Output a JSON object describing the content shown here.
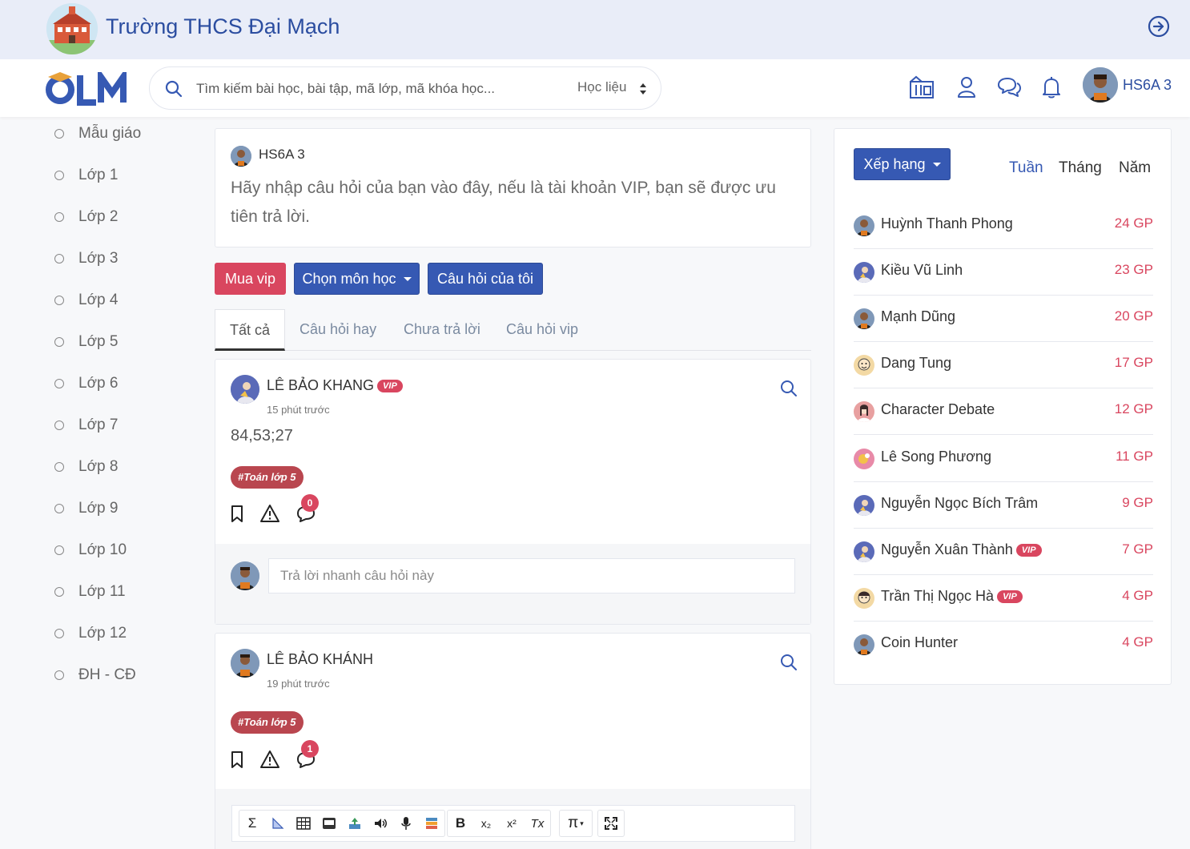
{
  "school": {
    "name": "Trường THCS Đại Mạch"
  },
  "navbar": {
    "logo_text": "OLM",
    "search_placeholder": "Tìm kiếm bài học, bài tập, mã lớp, mã khóa học...",
    "search_scope": "Học liệu",
    "user_name": "HS6A 3"
  },
  "sidebar": {
    "items": [
      "Mẫu giáo",
      "Lớp 1",
      "Lớp 2",
      "Lớp 3",
      "Lớp 4",
      "Lớp 5",
      "Lớp 6",
      "Lớp 7",
      "Lớp 8",
      "Lớp 9",
      "Lớp 10",
      "Lớp 11",
      "Lớp 12",
      "ĐH - CĐ"
    ]
  },
  "ask": {
    "user": "HS6A 3",
    "prompt": "Hãy nhập câu hỏi của bạn vào đây, nếu là tài khoản VIP, bạn sẽ được ưu tiên trả lời."
  },
  "actions": {
    "buy_vip": "Mua vip",
    "choose_subject": "Chọn môn học",
    "my_questions": "Câu hỏi của tôi"
  },
  "tabs": [
    "Tất cả",
    "Câu hỏi hay",
    "Chưa trả lời",
    "Câu hỏi vip"
  ],
  "questions": [
    {
      "author": "LÊ BẢO KHANG",
      "vip": "VIP",
      "time": "15 phút trước",
      "body": "84,53;27",
      "tag": "#Toán lớp 5",
      "comments": "0",
      "reply_placeholder": "Trả lời nhanh câu hỏi này"
    },
    {
      "author": "LÊ BẢO KHÁNH",
      "time": "19 phút trước",
      "tag": "#Toán lớp 5",
      "comments": "1"
    }
  ],
  "editor_tools": {
    "sum": "Σ",
    "bold": "B",
    "sub": "x₂",
    "sup": "x²",
    "clear": "Tx",
    "pi": "π"
  },
  "ranking": {
    "button": "Xếp hạng",
    "periods": [
      "Tuần",
      "Tháng",
      "Năm"
    ],
    "active_period": "Tuần",
    "rows": [
      {
        "name": "Huỳnh Thanh Phong",
        "gp": "24 GP"
      },
      {
        "name": "Kiều Vũ Linh",
        "gp": "23 GP"
      },
      {
        "name": "Mạnh Dũng",
        "gp": "20 GP"
      },
      {
        "name": "Dang Tung",
        "gp": "17 GP"
      },
      {
        "name": "Character Debate",
        "gp": "12 GP"
      },
      {
        "name": "Lê Song Phương",
        "gp": "11 GP"
      },
      {
        "name": "Nguyễn Ngọc Bích Trâm",
        "gp": "9 GP"
      },
      {
        "name": "Nguyễn Xuân Thành",
        "gp": "7 GP",
        "vip": "VIP"
      },
      {
        "name": "Trần Thị Ngọc Hà",
        "gp": "4 GP",
        "vip": "VIP"
      },
      {
        "name": "Coin Hunter",
        "gp": "4 GP"
      }
    ]
  },
  "colors": {
    "brand_blue": "#3659b3",
    "title_blue": "#2b4da0",
    "vip_red": "#d9465f",
    "tag_red": "#b9464f"
  }
}
